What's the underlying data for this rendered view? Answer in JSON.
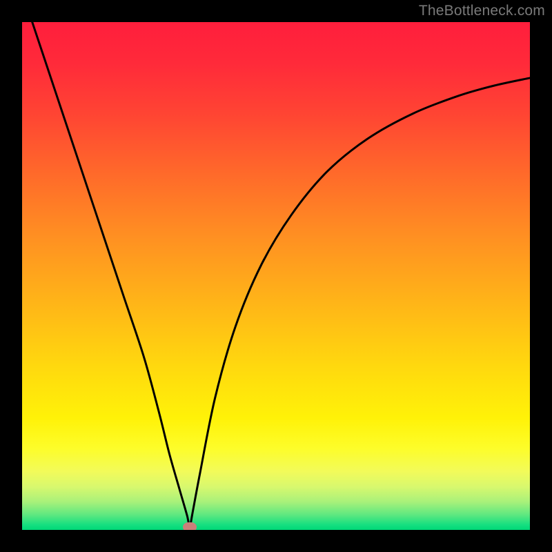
{
  "watermark": {
    "text": "TheBottleneck.com"
  },
  "colors": {
    "black": "#000000",
    "curve": "#000000",
    "marker": "#c9807a",
    "gradient_stops": [
      {
        "offset": 0.0,
        "color": "#ff1e3c"
      },
      {
        "offset": 0.08,
        "color": "#ff2a3a"
      },
      {
        "offset": 0.18,
        "color": "#ff4433"
      },
      {
        "offset": 0.3,
        "color": "#ff6a2a"
      },
      {
        "offset": 0.42,
        "color": "#ff8f22"
      },
      {
        "offset": 0.55,
        "color": "#ffb418"
      },
      {
        "offset": 0.68,
        "color": "#ffd90e"
      },
      {
        "offset": 0.78,
        "color": "#fff208"
      },
      {
        "offset": 0.84,
        "color": "#fdfd2a"
      },
      {
        "offset": 0.885,
        "color": "#f2fb5a"
      },
      {
        "offset": 0.915,
        "color": "#d8f86e"
      },
      {
        "offset": 0.945,
        "color": "#a8f17a"
      },
      {
        "offset": 0.97,
        "color": "#5fe880"
      },
      {
        "offset": 0.99,
        "color": "#15df80"
      },
      {
        "offset": 1.0,
        "color": "#00d877"
      }
    ]
  },
  "chart_data": {
    "type": "line",
    "title": "",
    "xlabel": "",
    "ylabel": "",
    "xlim": [
      0,
      100
    ],
    "ylim": [
      0,
      100
    ],
    "grid": false,
    "min_x": 33,
    "marker": {
      "x": 33,
      "y": 0.6
    },
    "series": [
      {
        "name": "bottleneck-curve",
        "x": [
          0,
          4,
          8,
          12,
          16,
          20,
          24,
          27,
          29,
          31,
          32.5,
          33,
          33.5,
          35,
          38,
          42,
          47,
          53,
          60,
          68,
          77,
          86,
          93,
          100
        ],
        "y": [
          106,
          94,
          82,
          70,
          58,
          46,
          34,
          23,
          15,
          8,
          2.8,
          0.5,
          3.0,
          11,
          26,
          40,
          52,
          62,
          70.5,
          77,
          82,
          85.5,
          87.5,
          89
        ]
      }
    ]
  }
}
